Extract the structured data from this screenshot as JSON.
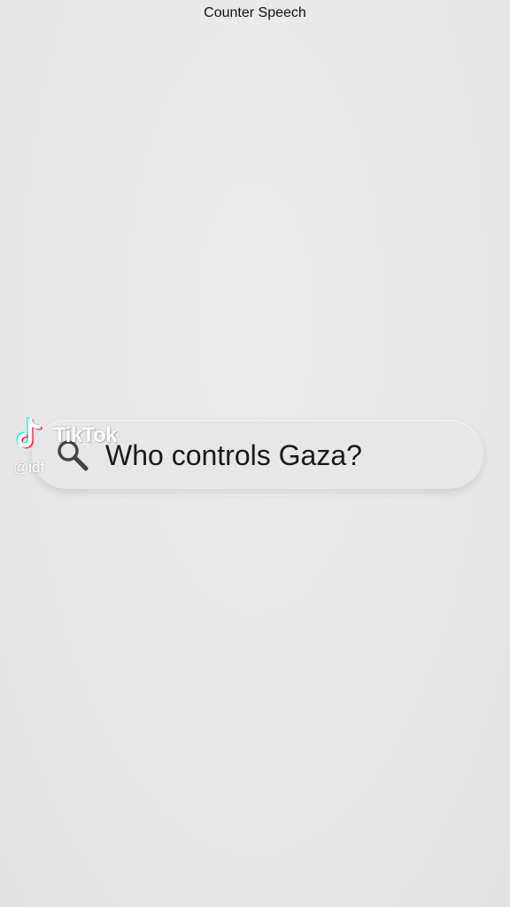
{
  "header": {
    "title": "Counter Speech"
  },
  "search": {
    "query": "Who controls Gaza?",
    "icon": "search-icon"
  },
  "watermark": {
    "brand": "TikTok",
    "handle": "@idf",
    "icon": "tiktok-logo-icon"
  },
  "colors": {
    "background": "#e9e9e9",
    "search_bar": "#e7e7e7",
    "text": "#1a1a1a",
    "tiktok_cyan": "#25f4ee",
    "tiktok_red": "#fe2c55"
  }
}
